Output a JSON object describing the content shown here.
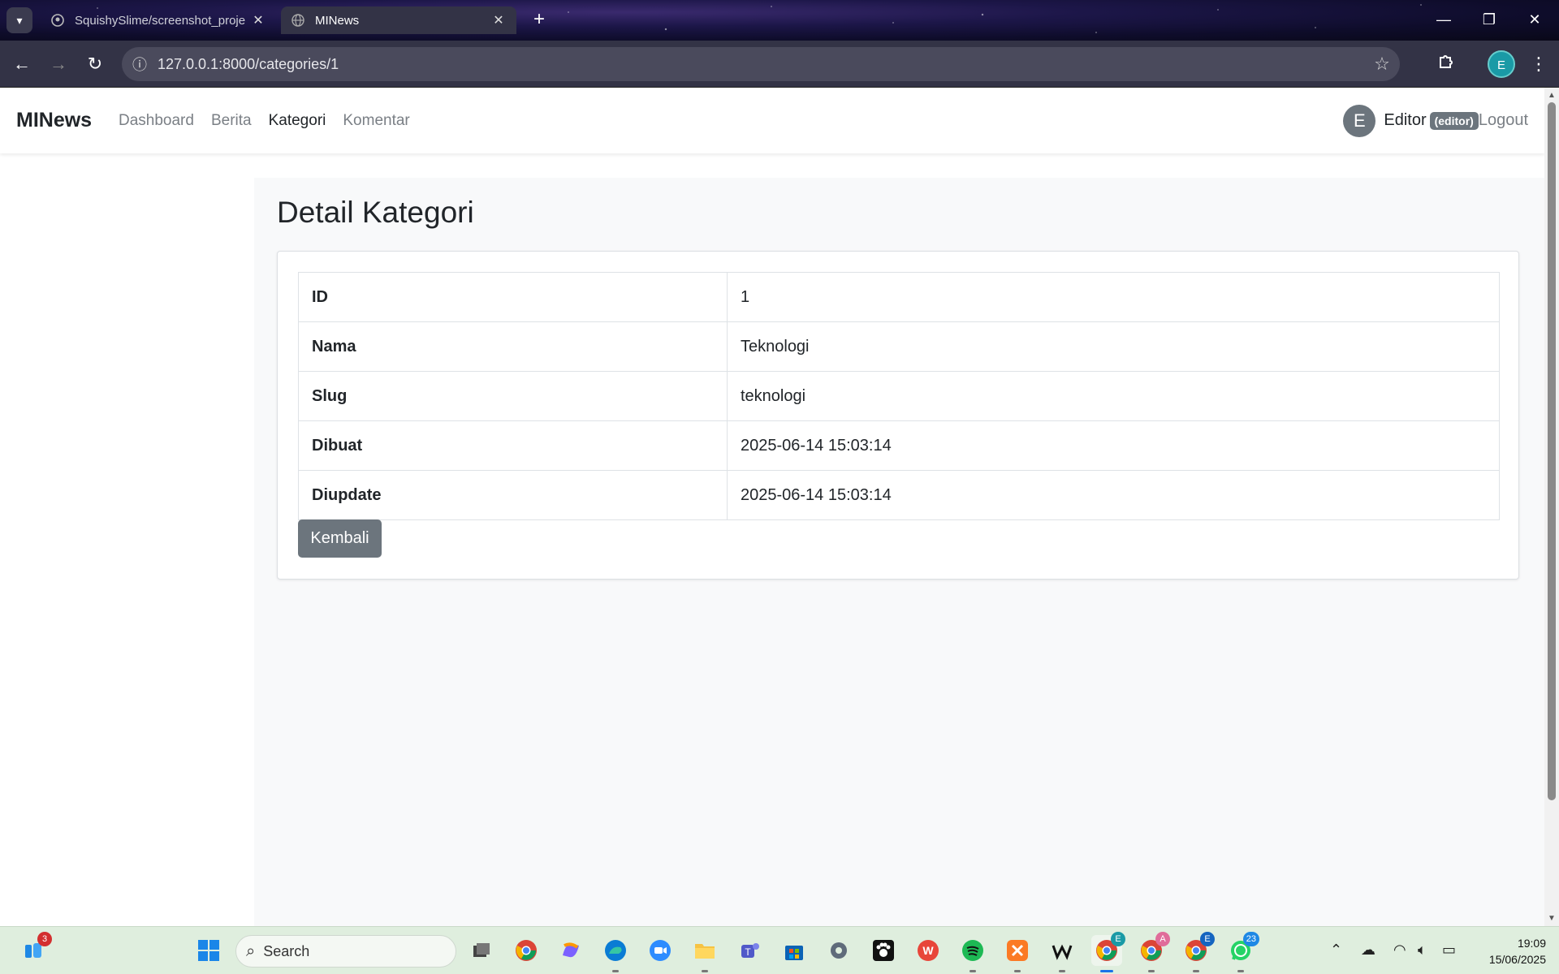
{
  "browser": {
    "tabs": [
      {
        "title": "SquishySlime/screenshot_proje",
        "active": false,
        "icon": "github-icon"
      },
      {
        "title": "MINews",
        "active": true,
        "icon": "globe-icon"
      }
    ],
    "url": "127.0.0.1:8000/categories/1",
    "profile_initial": "E"
  },
  "app": {
    "brand": "MINews",
    "nav": {
      "dashboard": "Dashboard",
      "berita": "Berita",
      "kategori": "Kategori",
      "komentar": "Komentar"
    },
    "active_nav": "Kategori",
    "user": {
      "initial": "E",
      "name": "Editor",
      "role": "(editor)",
      "logout": "Logout"
    }
  },
  "page": {
    "title": "Detail Kategori",
    "rows": [
      {
        "label": "ID",
        "value": "1"
      },
      {
        "label": "Nama",
        "value": "Teknologi"
      },
      {
        "label": "Slug",
        "value": "teknologi"
      },
      {
        "label": "Dibuat",
        "value": "2025-06-14 15:03:14"
      },
      {
        "label": "Diupdate",
        "value": "2025-06-14 15:03:14"
      }
    ],
    "back_button": "Kembali"
  },
  "taskbar": {
    "search_placeholder": "Search",
    "widget_badge": "3",
    "whatsapp_badge": "23",
    "chrome_profile_badges": [
      "E",
      "A",
      "E"
    ],
    "time": "19:09",
    "date": "15/06/2025"
  },
  "colors": {
    "secondary": "#6c757d",
    "main_bg": "#f8f9fa"
  }
}
